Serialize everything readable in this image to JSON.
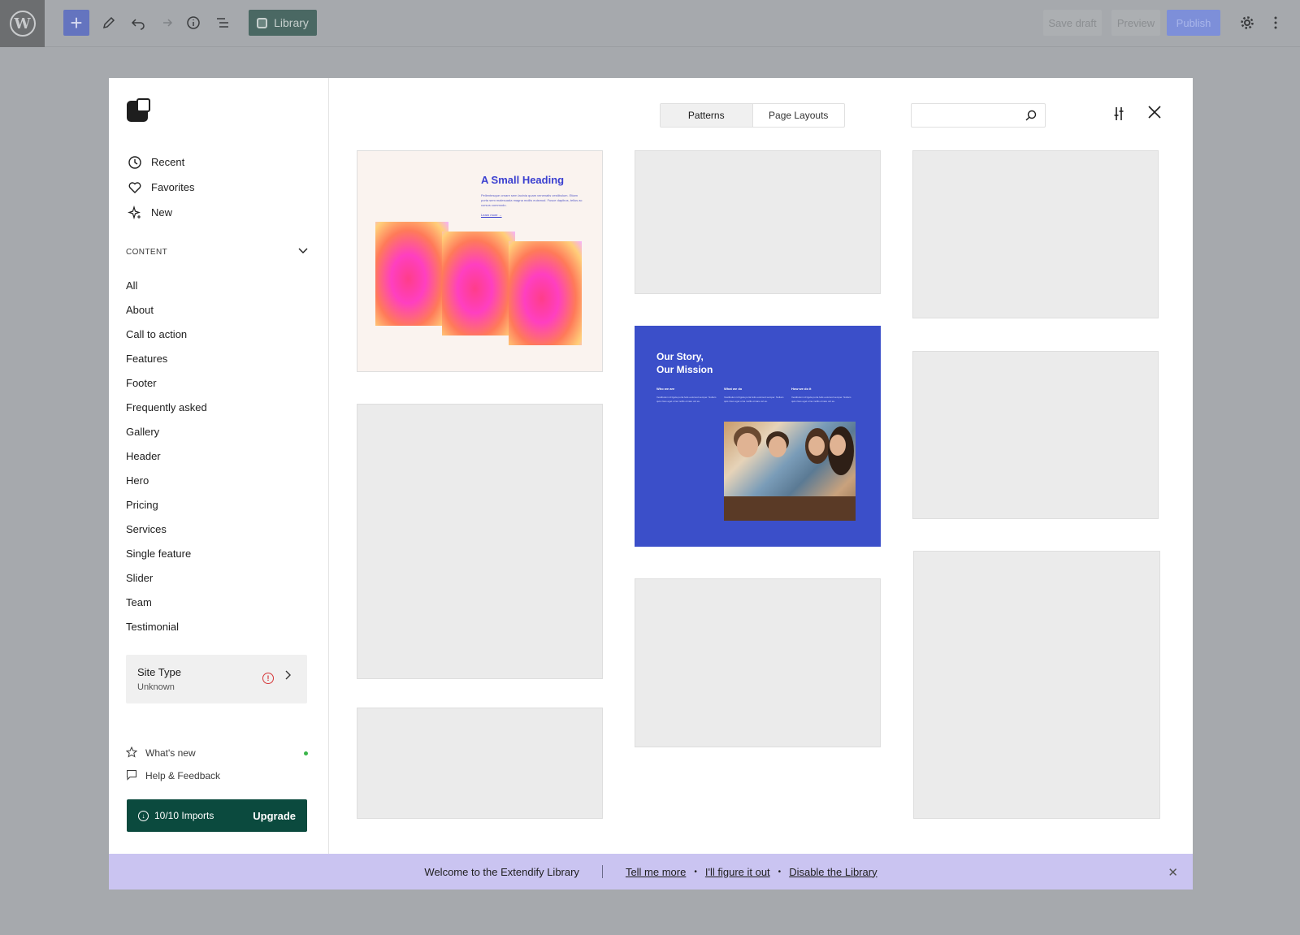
{
  "toolbar": {
    "library_label": "Library",
    "save_draft": "Save draft",
    "preview": "Preview",
    "publish": "Publish"
  },
  "sidebar": {
    "top_items": [
      {
        "label": "Recent",
        "icon": "clock-icon"
      },
      {
        "label": "Favorites",
        "icon": "heart-icon"
      },
      {
        "label": "New",
        "icon": "sparkle-icon"
      }
    ],
    "content_heading": "CONTENT",
    "categories": [
      "All",
      "About",
      "Call to action",
      "Features",
      "Footer",
      "Frequently asked",
      "Gallery",
      "Header",
      "Hero",
      "Pricing",
      "Services",
      "Single feature",
      "Slider",
      "Team",
      "Testimonial"
    ],
    "site_type": {
      "label": "Site Type",
      "value": "Unknown"
    },
    "whats_new": "What's new",
    "help": "Help & Feedback",
    "imports": "10/10 Imports",
    "upgrade": "Upgrade"
  },
  "main": {
    "tabs": [
      "Patterns",
      "Page Layouts"
    ],
    "search_placeholder": "",
    "card1": {
      "heading": "A Small Heading",
      "text": "Pellentesque ornare sem lacinia quam venenatis vestibulum. Etiam porta sem malesuada magna mollis euismod. Fusce dapibus, tellus ac cursus commodo.",
      "link": "Learn more →"
    },
    "card_blue": {
      "heading_line1": "Our Story,",
      "heading_line2": "Our Mission",
      "columns": [
        {
          "title": "Who we are",
          "text": "Vestibulum id ligula porta felis euismod semper. Nullam quis risus eget urna mollis ornare vel eu."
        },
        {
          "title": "What we do",
          "text": "Vestibulum id ligula porta felis euismod semper. Nullam quis risus eget urna mollis ornare vel eu."
        },
        {
          "title": "How we do it",
          "text": "Vestibulum id ligula porta felis euismod semper. Nullam quis risus eget urna mollis ornare vel eu."
        }
      ]
    }
  },
  "notice": {
    "welcome": "Welcome to the Extendify Library",
    "tell_more": "Tell me more",
    "figure_out": "I'll figure it out",
    "disable": "Disable the Library"
  }
}
